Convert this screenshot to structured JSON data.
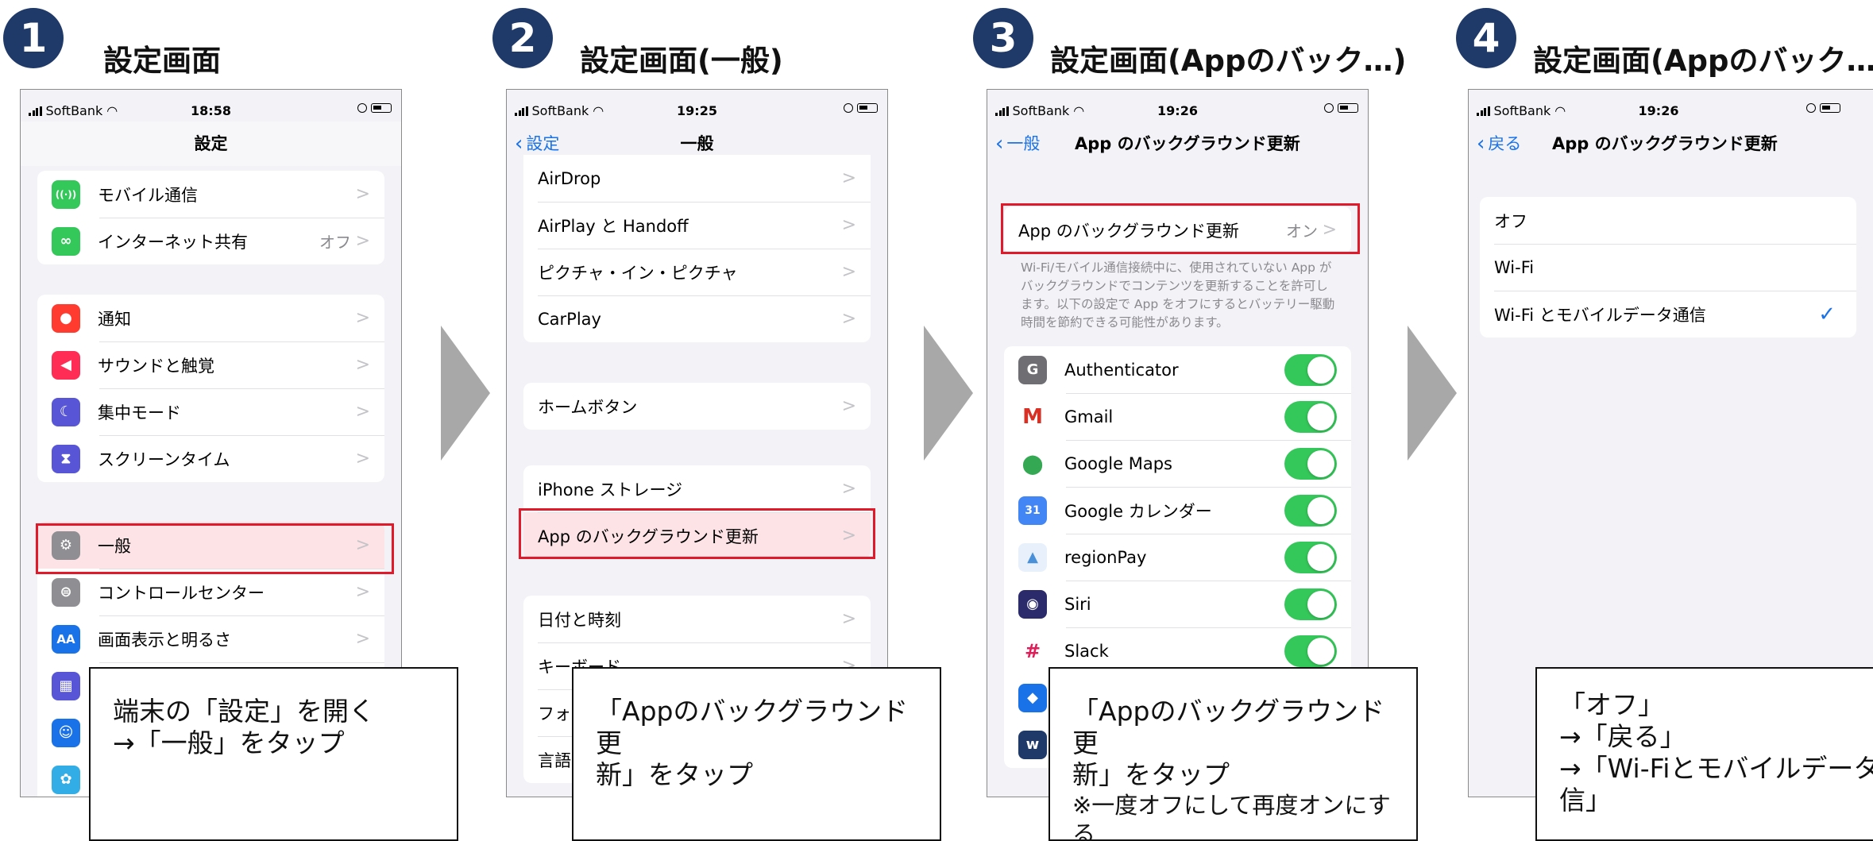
{
  "steps": [
    {
      "number": "1",
      "title": "設定画面"
    },
    {
      "number": "2",
      "title": "設定画面(一般)"
    },
    {
      "number": "3",
      "title": "設定画面(Appのバック…)"
    },
    {
      "number": "4",
      "title": "設定画面(Appのバック…)"
    }
  ],
  "screen1": {
    "carrier": "SoftBank",
    "time": "18:58",
    "title": "設定",
    "group1": [
      {
        "label": "モバイル通信",
        "icon": "antenna-icon",
        "color": "#34c759",
        "glyph": "((·))"
      },
      {
        "label": "インターネット共有",
        "value": "オフ",
        "icon": "link-icon",
        "color": "#34c759",
        "glyph": "∞"
      }
    ],
    "group2": [
      {
        "label": "通知",
        "icon": "bell-icon",
        "color": "#ff3b30",
        "glyph": "●"
      },
      {
        "label": "サウンドと触覚",
        "icon": "speaker-icon",
        "color": "#ff2d55",
        "glyph": "◀"
      },
      {
        "label": "集中モード",
        "icon": "moon-icon",
        "color": "#5856d6",
        "glyph": "☾"
      },
      {
        "label": "スクリーンタイム",
        "icon": "hourglass-icon",
        "color": "#5856d6",
        "glyph": "⧗"
      }
    ],
    "group3": [
      {
        "label": "一般",
        "icon": "gear-icon",
        "color": "#8e8e93",
        "glyph": "⚙"
      },
      {
        "label": "コントロールセンター",
        "icon": "switches-icon",
        "color": "#8e8e93",
        "glyph": "⊜"
      },
      {
        "label": "画面表示と明るさ",
        "icon": "text-size-icon",
        "color": "#1a72e8",
        "glyph": "AA"
      }
    ],
    "callout": [
      "端末の「設定」を開く",
      "→「一般」をタップ"
    ]
  },
  "screen2": {
    "carrier": "SoftBank",
    "time": "19:25",
    "back": "設定",
    "title": "一般",
    "group1": [
      "AirDrop",
      "AirPlay と Handoff",
      "ピクチャ・イン・ピクチャ",
      "CarPlay"
    ],
    "group2": [
      "ホームボタン"
    ],
    "group3": [
      "iPhone ストレージ",
      "App のバックグラウンド更新"
    ],
    "group4": [
      "日付と時刻",
      "キーボード"
    ],
    "partial": [
      "フォ",
      "言語"
    ],
    "callout": [
      "「Appのバックグラウンド更",
      "新」をタップ"
    ]
  },
  "screen3": {
    "carrier": "SoftBank",
    "time": "19:26",
    "back": "一般",
    "title": "App のバックグラウンド更新",
    "main_row": {
      "label": "App のバックグラウンド更新",
      "value": "オン"
    },
    "note": [
      "Wi-Fi/モバイル通信接続中に、使用されていない App が",
      "バックグラウンドでコンテンツを更新することを許可し",
      "ます。以下の設定で App をオフにするとバッテリー駆動",
      "時間を節約できる可能性があります。"
    ],
    "apps": [
      {
        "label": "Authenticator",
        "icon": "authenticator-icon",
        "color": "#6e6e73",
        "glyph": "G"
      },
      {
        "label": "Gmail",
        "icon": "gmail-icon",
        "color": "#ffffff",
        "glyph": "M",
        "fg": "#d93025"
      },
      {
        "label": "Google Maps",
        "icon": "google-maps-icon",
        "color": "#ffffff",
        "glyph": "⬤",
        "fg": "#34a853"
      },
      {
        "label": "Google カレンダー",
        "icon": "google-calendar-icon",
        "color": "#4285f4",
        "glyph": "31"
      },
      {
        "label": "regionPay",
        "icon": "regionpay-icon",
        "color": "#e8f1fb",
        "glyph": "▲",
        "fg": "#4a90d9"
      },
      {
        "label": "Siri",
        "icon": "siri-icon",
        "color": "#2b2b6b",
        "glyph": "◉"
      },
      {
        "label": "Slack",
        "icon": "slack-icon",
        "color": "#ffffff",
        "glyph": "#",
        "fg": "#e01e5a"
      }
    ],
    "callout": [
      "「Appのバックグラウンド更",
      "新」をタップ"
    ],
    "callout_sub": "※一度オフにして再度オンにする"
  },
  "screen4": {
    "carrier": "SoftBank",
    "time": "19:26",
    "back": "戻る",
    "title": "App のバックグラウンド更新",
    "options": [
      "オフ",
      "Wi-Fi",
      "Wi-Fi とモバイルデータ通信"
    ],
    "selected_index": 2,
    "check": "✓",
    "callout": [
      "「オフ」",
      "→「戻る」",
      "→「Wi-Fiとモバイルデータ通",
      "信」"
    ]
  },
  "chevron": ">",
  "colors": {
    "badge": "#1f3a68",
    "highlight": "#e01a2a",
    "toggle_on": "#34c759",
    "link": "#1a72e8"
  }
}
